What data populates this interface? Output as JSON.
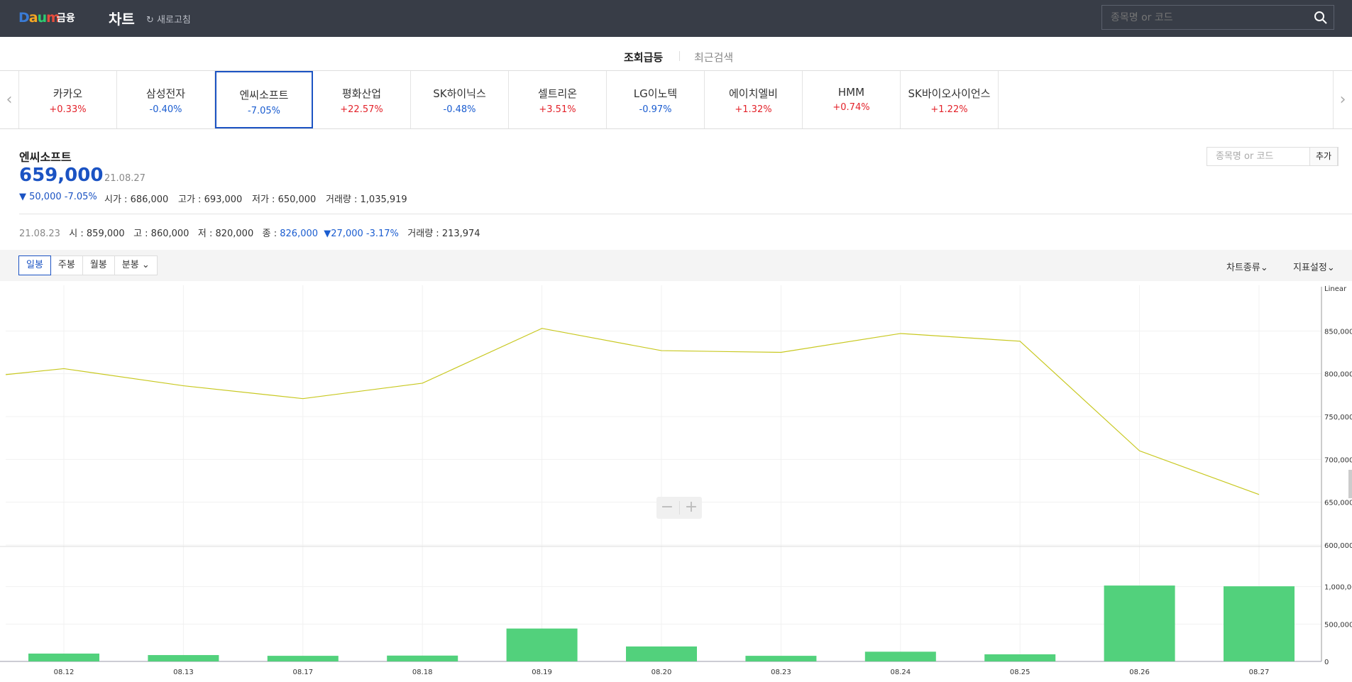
{
  "header": {
    "logo": "Daum",
    "logo_sub": "금융",
    "title": "차트",
    "refresh_label": "새로고침",
    "search_placeholder": "종목명 or 코드"
  },
  "tabs": [
    "조회급등",
    "최근검색"
  ],
  "stocks": [
    {
      "name": "카카오",
      "change": "+0.33%",
      "dir": "up"
    },
    {
      "name": "삼성전자",
      "change": "-0.40%",
      "dir": "down"
    },
    {
      "name": "엔씨소프트",
      "change": "-7.05%",
      "dir": "down",
      "active": true
    },
    {
      "name": "평화산업",
      "change": "+22.57%",
      "dir": "up"
    },
    {
      "name": "SK하이닉스",
      "change": "-0.48%",
      "dir": "down"
    },
    {
      "name": "셀트리온",
      "change": "+3.51%",
      "dir": "up"
    },
    {
      "name": "LG이노텍",
      "change": "-0.97%",
      "dir": "down"
    },
    {
      "name": "에이치엘비",
      "change": "+1.32%",
      "dir": "up"
    },
    {
      "name": "HMM",
      "change": "+0.74%",
      "dir": "up"
    },
    {
      "name": "SK바이오사이언스",
      "change": "+1.22%",
      "dir": "up"
    }
  ],
  "quote": {
    "name": "엔씨소프트",
    "price": "659,000",
    "date": "21.08.27",
    "change": "▼ 50,000 -7.05%",
    "open": "시가 : 686,000",
    "high": "고가 : 693,000",
    "low": "저가 : 650,000",
    "volume": "거래량 : 1,035,919"
  },
  "hover": {
    "date": "21.08.23",
    "open": "시 : 859,000",
    "high": "고 : 860,000",
    "low": "저 : 820,000",
    "close_label": "종 : ",
    "close": "826,000",
    "change": "▼27,000 -3.17%",
    "volume": "거래량 : 213,974"
  },
  "add": {
    "placeholder": "종목명 or 코드",
    "button": "추가"
  },
  "periods": [
    "일봉",
    "주봉",
    "월봉",
    "분봉"
  ],
  "tools": {
    "chart_type": "차트종류",
    "indicators": "지표설정"
  },
  "colors": {
    "line": "#c8c820",
    "bar": "#52d17c",
    "up": "#e3222a",
    "down": "#1b5dd0",
    "accent": "#1b53c3"
  },
  "chart_data": [
    {
      "type": "line",
      "scale_label": "Linear",
      "x": [
        "08.12",
        "08.13",
        "08.17",
        "08.18",
        "08.19",
        "08.20",
        "08.23",
        "08.24",
        "08.25",
        "08.26",
        "08.27"
      ],
      "values": [
        806000,
        786000,
        771000,
        789000,
        853000,
        827000,
        825000,
        847000,
        838000,
        710000,
        659000
      ],
      "prev_edge_value": 799000,
      "ylim": [
        600000,
        900000
      ],
      "yticks": [
        "850,000",
        "800,000",
        "750,000",
        "700,000",
        "650,000",
        "600,000"
      ]
    },
    {
      "type": "bar",
      "x": [
        "08.12",
        "08.13",
        "08.17",
        "08.18",
        "08.19",
        "08.20",
        "08.23",
        "08.24",
        "08.25",
        "08.26",
        "08.27"
      ],
      "values": [
        105000,
        85000,
        75000,
        78000,
        440000,
        200000,
        75000,
        130000,
        95000,
        1015000,
        1005000
      ],
      "ylim": [
        0,
        1500000
      ],
      "yticks": [
        "1,000,000",
        "500,000",
        "0"
      ]
    }
  ]
}
